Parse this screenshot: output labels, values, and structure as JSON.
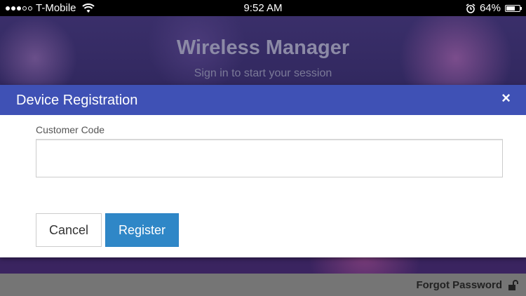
{
  "status_bar": {
    "carrier": "T-Mobile",
    "time": "9:52 AM",
    "battery_percent": "64%",
    "battery_level": 0.64
  },
  "background": {
    "title": "Wireless Manager",
    "subtitle": "Sign in to start your session",
    "forgot_password": "Forgot Password"
  },
  "modal": {
    "title": "Device Registration",
    "close_glyph": "×",
    "field_label": "Customer Code",
    "field_value": "",
    "cancel_label": "Cancel",
    "register_label": "Register"
  },
  "colors": {
    "header": "#3f51b5",
    "register": "#2f87c7"
  }
}
